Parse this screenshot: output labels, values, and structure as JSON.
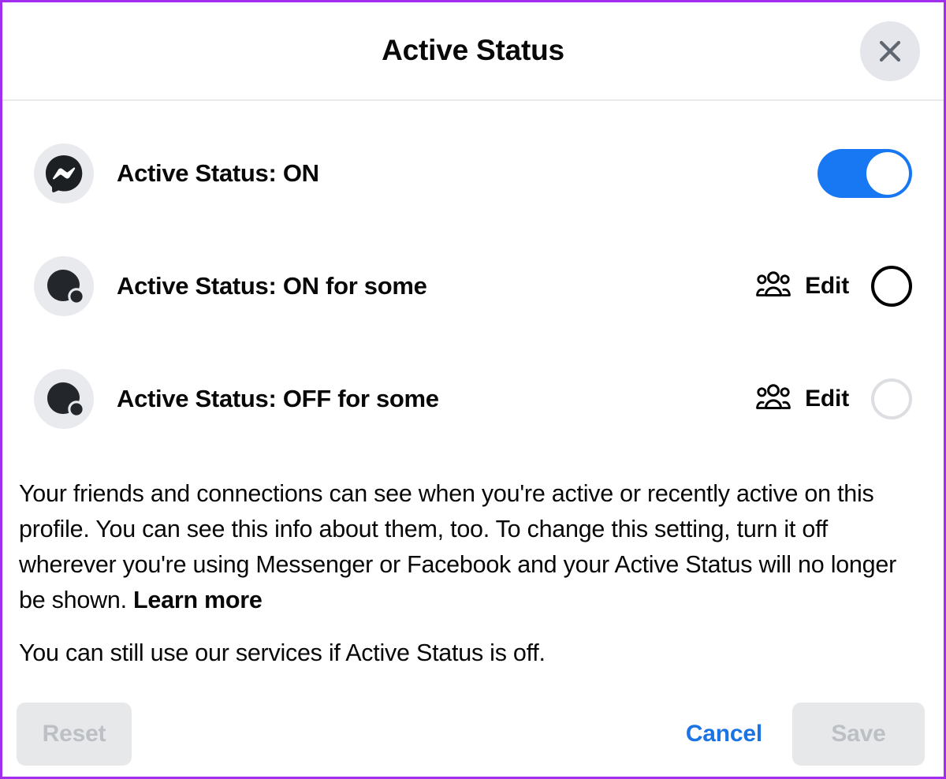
{
  "dialog": {
    "title": "Active Status",
    "border_color": "#a22ef0",
    "close_icon": "close-icon"
  },
  "options": [
    {
      "icon": "messenger-logo-icon",
      "label": "Active Status: ON",
      "control": "toggle",
      "toggle_on": true,
      "toggle_color": "#1877f2",
      "has_edit": false
    },
    {
      "icon": "active-status-dot-icon",
      "label": "Active Status: ON for some",
      "control": "radio",
      "selected": false,
      "has_edit": true,
      "edit_label": "Edit",
      "people_icon": "people-group-icon",
      "radio_state": "enabled"
    },
    {
      "icon": "active-status-dot-icon",
      "label": "Active Status: OFF for some",
      "control": "radio",
      "selected": false,
      "has_edit": true,
      "edit_label": "Edit",
      "people_icon": "people-group-icon",
      "radio_state": "muted"
    }
  ],
  "description": {
    "paragraph1_part1": "Your friends and connections can see when you're active or recently active on this profile. You can see this info about them, too. To change this setting, turn it off wherever you're using Messenger or Facebook and your Active Status will no longer be shown. ",
    "learn_more": "Learn more",
    "paragraph2": "You can still use our services if Active Status is off."
  },
  "footer": {
    "reset_label": "Reset",
    "cancel_label": "Cancel",
    "save_label": "Save",
    "cancel_color": "#1b74e4",
    "disabled_text_color": "#bcc0c4"
  }
}
